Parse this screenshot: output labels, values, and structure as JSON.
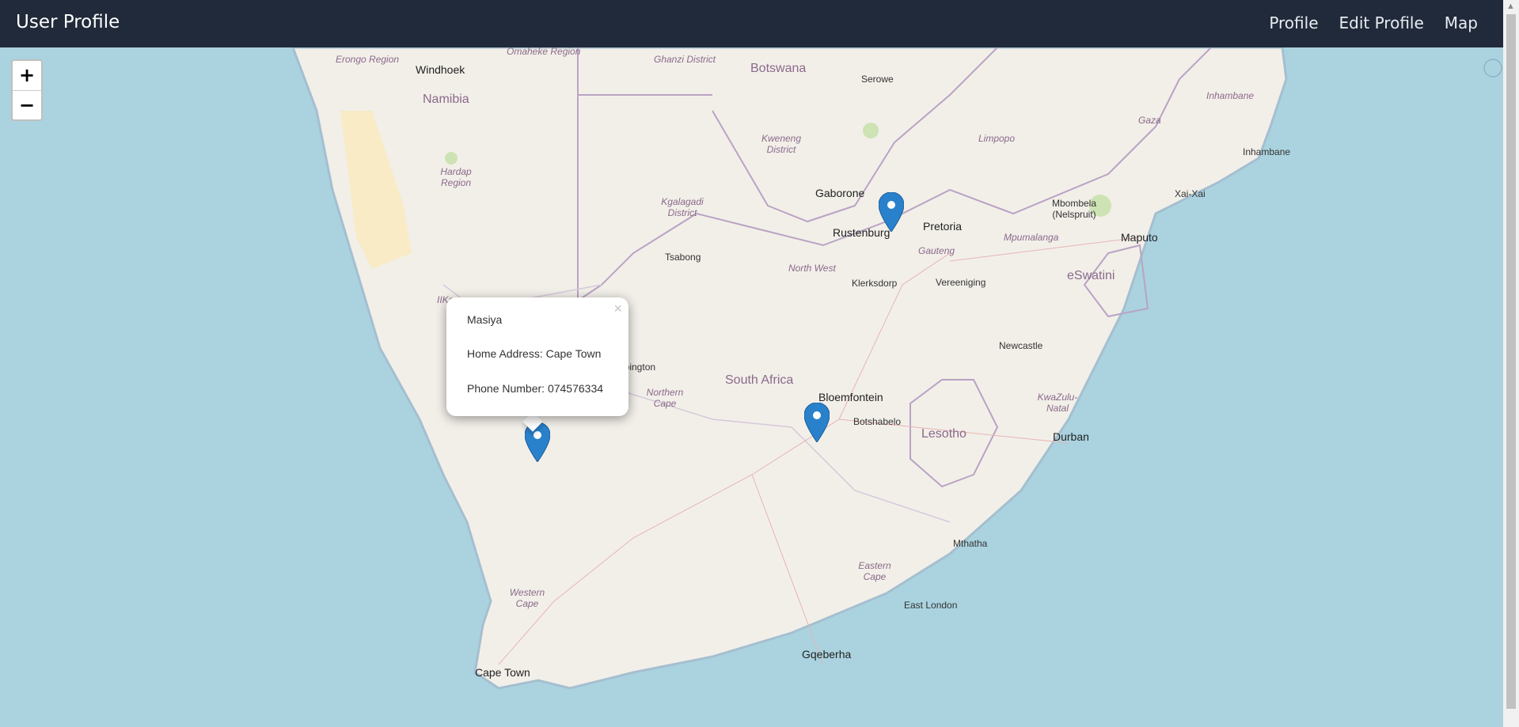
{
  "navbar": {
    "brand": "User Profile",
    "links": [
      {
        "label": "Profile"
      },
      {
        "label": "Edit Profile"
      },
      {
        "label": "Map"
      }
    ]
  },
  "map": {
    "zoom_in": "+",
    "zoom_out": "−",
    "labels": {
      "countries": [
        "Namibia",
        "Botswana",
        "South Africa",
        "Lesotho",
        "eSwatini"
      ],
      "regions": [
        "Erongo Region",
        "Omaheke Region",
        "Ghanzi District",
        "Hardap Region",
        "Kweneng District",
        "Kgalagadi District",
        "North West",
        "Gauteng",
        "Mpumalanga",
        "Limpopo",
        "Inhambane",
        "Gaza",
        "Northern Cape",
        "KwaZulu-Natal",
        "Eastern Cape",
        "Western Cape",
        "IIKaras"
      ],
      "cities": [
        "Windhoek",
        "Serowe",
        "Gaborone",
        "Rustenburg",
        "Pretoria",
        "Tsabong",
        "Klerksdorp",
        "Vereeniging",
        "Mbombela (Nelspruit)",
        "Maputo",
        "Xai-Xai",
        "Inhambane",
        "Newcastle",
        "Upington",
        "Bloemfontein",
        "Botshabelo",
        "Durban",
        "Mthatha",
        "East London",
        "Gqeberha",
        "Cape Town"
      ]
    },
    "popup": {
      "name": "Masiya",
      "home_address": "Home Address: Cape Town",
      "phone": "Phone Number: 074576334",
      "close": "×"
    },
    "marker_count": 3
  },
  "colors": {
    "navbar": "#212a3a",
    "ocean": "#aad3df",
    "land": "#f2efe9",
    "marker": "#2a81cb"
  }
}
